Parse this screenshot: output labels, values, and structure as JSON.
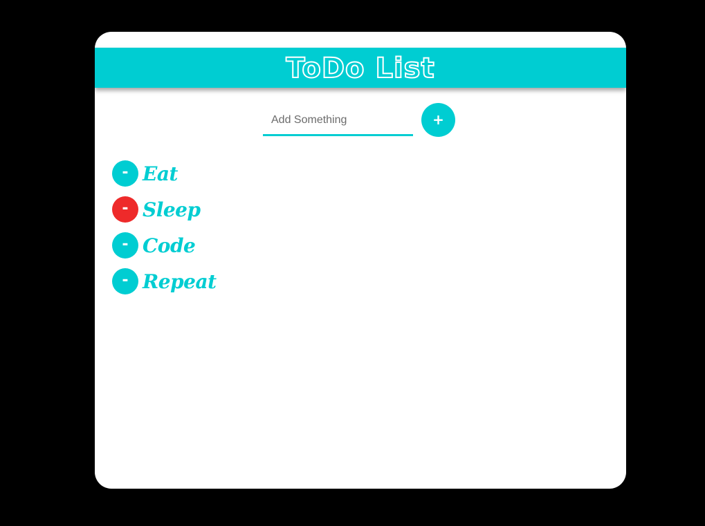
{
  "app": {
    "title": "ToDo List"
  },
  "add": {
    "placeholder": "Add Something",
    "value": "",
    "button_label": "+"
  },
  "todos": [
    {
      "text": "Eat",
      "button_label": "-",
      "button_color": "#00cdd2"
    },
    {
      "text": "Sleep",
      "button_label": "-",
      "button_color": "#ee2a2a"
    },
    {
      "text": "Code",
      "button_label": "-",
      "button_color": "#00cdd2"
    },
    {
      "text": "Repeat",
      "button_label": "-",
      "button_color": "#00cdd2"
    }
  ],
  "colors": {
    "accent": "#00cdd2",
    "danger": "#ee2a2a",
    "background": "#000000",
    "card": "#ffffff"
  }
}
